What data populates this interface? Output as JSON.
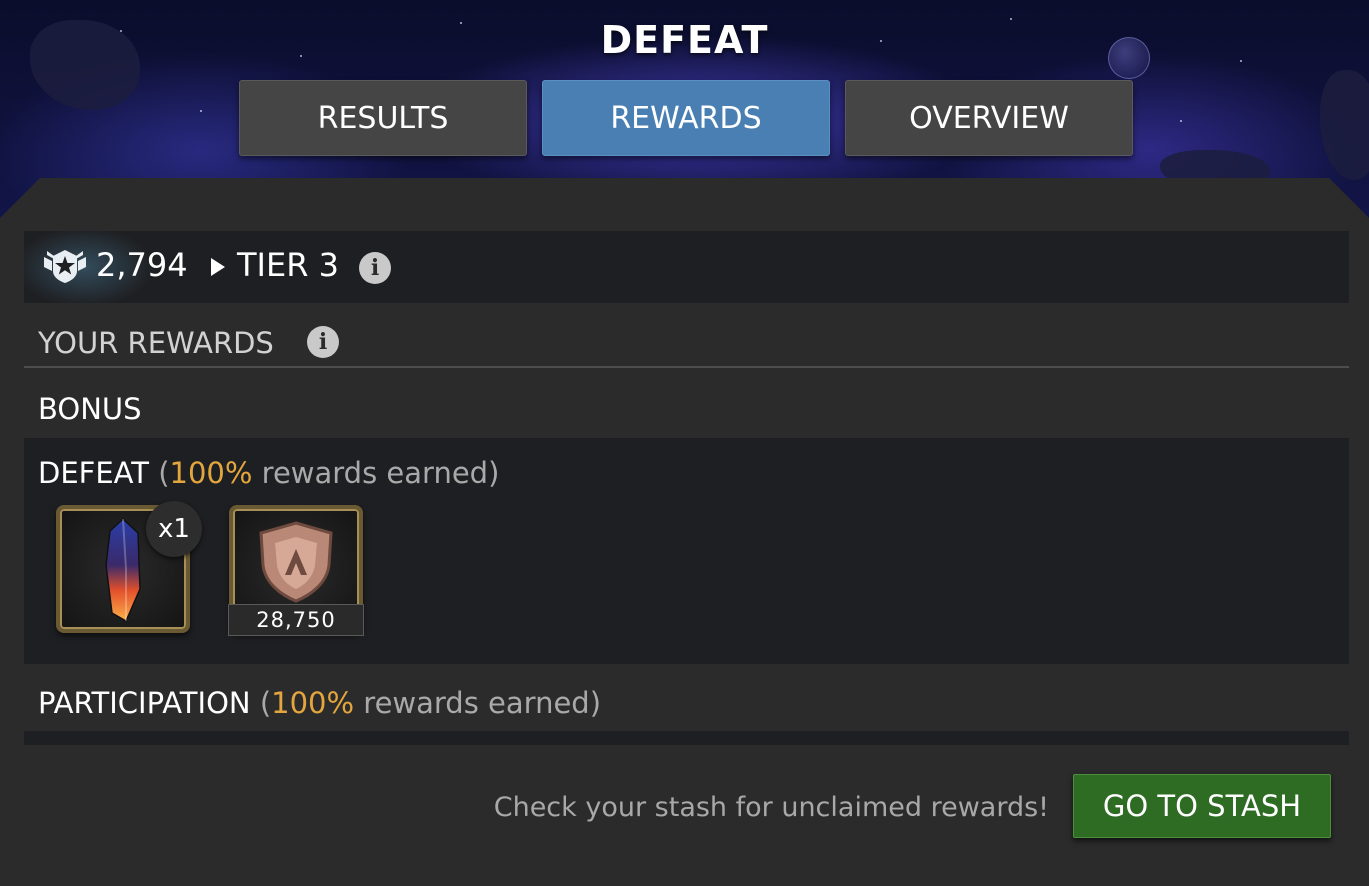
{
  "header": {
    "title": "DEFEAT",
    "tabs": [
      {
        "label": "RESULTS",
        "active": false
      },
      {
        "label": "REWARDS",
        "active": true
      },
      {
        "label": "OVERVIEW",
        "active": false
      }
    ]
  },
  "tier": {
    "points": "2,794",
    "name": "TIER 3",
    "icon": "tier-badge-icon"
  },
  "rewards": {
    "heading": "YOUR REWARDS",
    "bonus_label": "BONUS",
    "defeat": {
      "label": "DEFEAT",
      "percent": "100%",
      "suffix": "rewards earned",
      "items": [
        {
          "icon": "crystal-icon",
          "quantity": "x1"
        },
        {
          "icon": "shield-medal-icon",
          "amount": "28,750"
        }
      ]
    },
    "participation": {
      "label": "PARTICIPATION",
      "percent": "100%",
      "suffix": "rewards earned"
    }
  },
  "footer": {
    "message": "Check your stash for unclaimed rewards!",
    "button_label": "GO TO STASH"
  },
  "colors": {
    "accent_tab": "#4a7fb3",
    "percent": "#e3a63c",
    "stash_button": "#2e6b23"
  }
}
